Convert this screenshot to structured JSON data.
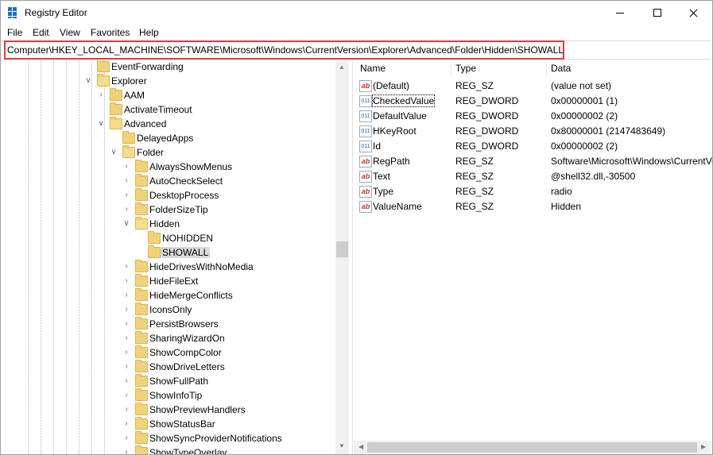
{
  "window": {
    "title": "Registry Editor"
  },
  "menu": {
    "file": "File",
    "edit": "Edit",
    "view": "View",
    "favorites": "Favorites",
    "help": "Help"
  },
  "address": {
    "path": "Computer\\HKEY_LOCAL_MACHINE\\SOFTWARE\\Microsoft\\Windows\\CurrentVersion\\Explorer\\Advanced\\Folder\\Hidden\\SHOWALL"
  },
  "tree": {
    "items": [
      {
        "label": "EventForwarding",
        "expander": "none"
      },
      {
        "label": "Explorer",
        "expander": "expanded"
      },
      {
        "label": "AAM",
        "expander": "collapsed"
      },
      {
        "label": "ActivateTimeout",
        "expander": "none"
      },
      {
        "label": "Advanced",
        "expander": "expanded"
      },
      {
        "label": "DelayedApps",
        "expander": "none"
      },
      {
        "label": "Folder",
        "expander": "expanded"
      },
      {
        "label": "AlwaysShowMenus",
        "expander": "collapsed"
      },
      {
        "label": "AutoCheckSelect",
        "expander": "collapsed"
      },
      {
        "label": "DesktopProcess",
        "expander": "collapsed"
      },
      {
        "label": "FolderSizeTip",
        "expander": "collapsed"
      },
      {
        "label": "Hidden",
        "expander": "expanded"
      },
      {
        "label": "NOHIDDEN",
        "expander": "none"
      },
      {
        "label": "SHOWALL",
        "expander": "none",
        "selected": true
      },
      {
        "label": "HideDrivesWithNoMedia",
        "expander": "collapsed"
      },
      {
        "label": "HideFileExt",
        "expander": "collapsed"
      },
      {
        "label": "HideMergeConflicts",
        "expander": "collapsed"
      },
      {
        "label": "IconsOnly",
        "expander": "collapsed"
      },
      {
        "label": "PersistBrowsers",
        "expander": "collapsed"
      },
      {
        "label": "SharingWizardOn",
        "expander": "collapsed"
      },
      {
        "label": "ShowCompColor",
        "expander": "collapsed"
      },
      {
        "label": "ShowDriveLetters",
        "expander": "collapsed"
      },
      {
        "label": "ShowFullPath",
        "expander": "collapsed"
      },
      {
        "label": "ShowInfoTip",
        "expander": "collapsed"
      },
      {
        "label": "ShowPreviewHandlers",
        "expander": "collapsed"
      },
      {
        "label": "ShowStatusBar",
        "expander": "collapsed"
      },
      {
        "label": "ShowSyncProviderNotifications",
        "expander": "collapsed"
      },
      {
        "label": "ShowTypeOverlay",
        "expander": "collapsed"
      }
    ]
  },
  "values": {
    "headers": {
      "name": "Name",
      "type": "Type",
      "data": "Data"
    },
    "rows": [
      {
        "icon": "string-value-icon",
        "name": "(Default)",
        "type": "REG_SZ",
        "data": "(value not set)"
      },
      {
        "icon": "dword-value-icon",
        "name": "CheckedValue",
        "type": "REG_DWORD",
        "data": "0x00000001 (1)"
      },
      {
        "icon": "dword-value-icon",
        "name": "DefaultValue",
        "type": "REG_DWORD",
        "data": "0x00000002 (2)"
      },
      {
        "icon": "dword-value-icon",
        "name": "HKeyRoot",
        "type": "REG_DWORD",
        "data": "0x80000001 (2147483649)"
      },
      {
        "icon": "dword-value-icon",
        "name": "Id",
        "type": "REG_DWORD",
        "data": "0x00000002 (2)"
      },
      {
        "icon": "string-value-icon",
        "name": "RegPath",
        "type": "REG_SZ",
        "data": "Software\\Microsoft\\Windows\\CurrentVersion\\Explorer\\Advanced"
      },
      {
        "icon": "string-value-icon",
        "name": "Text",
        "type": "REG_SZ",
        "data": "@shell32.dll,-30500"
      },
      {
        "icon": "string-value-icon",
        "name": "Type",
        "type": "REG_SZ",
        "data": "radio"
      },
      {
        "icon": "string-value-icon",
        "name": "ValueName",
        "type": "REG_SZ",
        "data": "Hidden"
      }
    ]
  },
  "colors": {
    "address_highlight": "#e03a3e",
    "folder": "#f0d27b",
    "selection": "#d9d9d9"
  }
}
